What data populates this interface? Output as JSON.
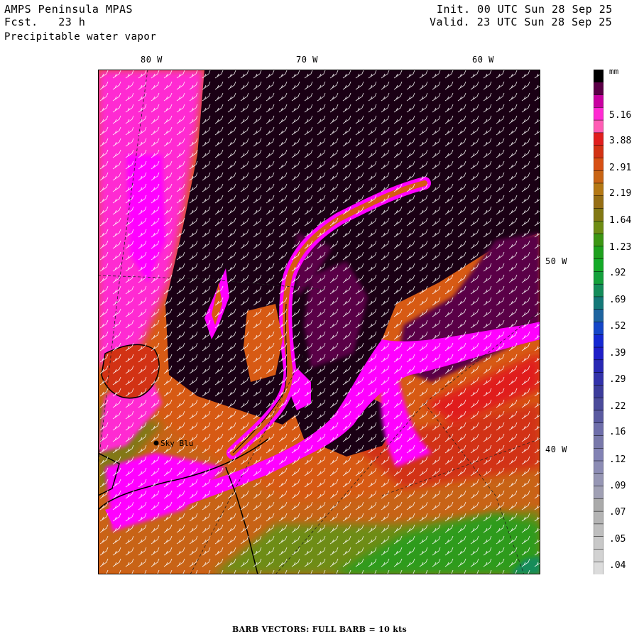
{
  "header": {
    "model": "AMPS Peninsula MPAS",
    "forecast": "Fcst.   23 h",
    "field": "Precipitable water vapor",
    "init": "Init. 00 UTC Sun 28 Sep 25",
    "valid": "Valid. 23 UTC Sun 28 Sep 25"
  },
  "map": {
    "lon_labels": [
      "80 W",
      "70 W",
      "60 W"
    ],
    "lat_labels": [
      "50 W",
      "40 W"
    ],
    "station": "Sky Blu",
    "background_colors": {
      "moist_band": "#ff00ff",
      "dry_core": "#1a0014",
      "orange": "#d75a14",
      "green": "#2e9b1e"
    }
  },
  "colorbar": {
    "unit": "mm",
    "labels": [
      "5.16",
      "3.88",
      "2.91",
      "2.19",
      "1.64",
      "1.23",
      ".92",
      ".69",
      ".52",
      ".39",
      ".29",
      ".22",
      ".16",
      ".12",
      ".09",
      ".07",
      ".05",
      ".04"
    ],
    "colors": [
      "#000000",
      "#5a0046",
      "#c800a0",
      "#ff2ad2",
      "#ff5cb4",
      "#e01e1e",
      "#d23214",
      "#d75014",
      "#c86414",
      "#b47814",
      "#966e14",
      "#827814",
      "#6e8c14",
      "#3c9614",
      "#1ea01e",
      "#14aa28",
      "#14a03c",
      "#148c5a",
      "#147878",
      "#1e64a0",
      "#1446c8",
      "#1428d2",
      "#1e1ec8",
      "#2828b4",
      "#3232aa",
      "#3c3c9b",
      "#4b4b9b",
      "#5a5aa0",
      "#6e6eaa",
      "#7878aa",
      "#8282b4",
      "#8c8cb4",
      "#9696b4",
      "#a0a0b4",
      "#aaaaaa",
      "#b4b4b4",
      "#bebebe",
      "#c8c8c8",
      "#d2d2d2",
      "#dcdcdc"
    ]
  },
  "footer": "BARB VECTORS:  FULL BARB = 10 kts"
}
